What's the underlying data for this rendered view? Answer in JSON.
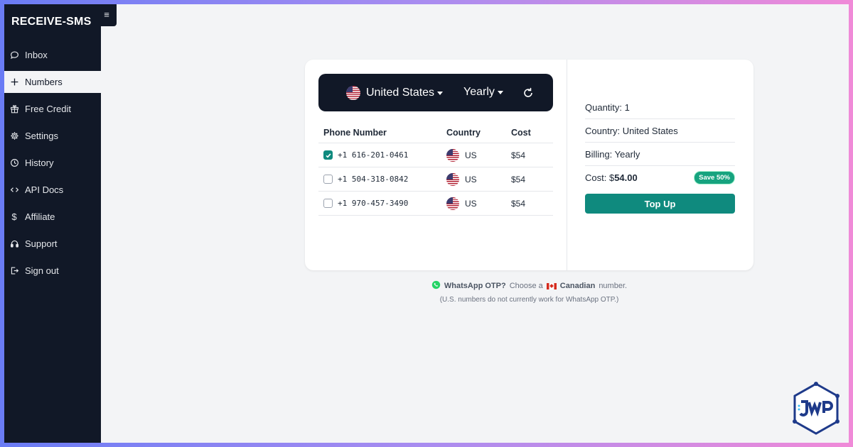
{
  "sidebar": {
    "brand": "RECEIVE-SMS",
    "menu_toggle": "≡",
    "items": [
      {
        "label": "Inbox",
        "icon": "chat-bubble-icon"
      },
      {
        "label": "Numbers",
        "icon": "plus-icon",
        "active": true
      },
      {
        "label": "Free Credit",
        "icon": "gift-icon"
      },
      {
        "label": "Settings",
        "icon": "gear-icon"
      },
      {
        "label": "History",
        "icon": "clock-icon"
      },
      {
        "label": "API Docs",
        "icon": "code-icon"
      },
      {
        "label": "Affiliate",
        "icon": "dollar-icon"
      },
      {
        "label": "Support",
        "icon": "headset-icon"
      },
      {
        "label": "Sign out",
        "icon": "sign-out-icon"
      }
    ]
  },
  "selector": {
    "country": "United States",
    "billing": "Yearly"
  },
  "table": {
    "headers": {
      "phone": "Phone Number",
      "country": "Country",
      "cost": "Cost"
    },
    "rows": [
      {
        "phone": "+1 616-201-0461",
        "country": "US",
        "cost": "$54",
        "checked": true
      },
      {
        "phone": "+1 504-318-0842",
        "country": "US",
        "cost": "$54",
        "checked": false
      },
      {
        "phone": "+1 970-457-3490",
        "country": "US",
        "cost": "$54",
        "checked": false
      }
    ]
  },
  "summary": {
    "quantity": "Quantity: 1",
    "country": "Country: United States",
    "billing": "Billing: Yearly",
    "cost_label": "Cost: $",
    "cost_value": "54.00",
    "badge": "Save 50%",
    "topup_label": "Top Up"
  },
  "note": {
    "whatsapp": "WhatsApp OTP?",
    "choose": "Choose a",
    "canadian": "Canadian",
    "number": "number.",
    "disclaimer": "(U.S. numbers do not currently work for WhatsApp OTP.)"
  },
  "colors": {
    "sidebar_bg": "#111827",
    "accent": "#0f8a7e",
    "badge": "#16a37f",
    "page_bg": "#f3f4f6"
  }
}
